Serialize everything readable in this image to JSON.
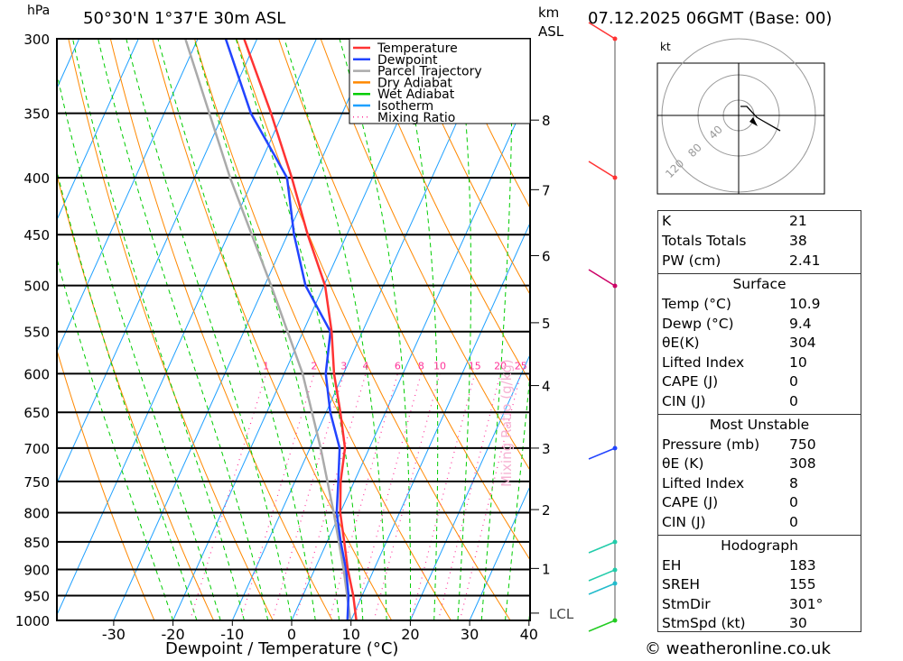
{
  "header": {
    "pressure_unit": "hPa",
    "location": "50°30'N 1°37'E 30m ASL",
    "km_unit": "km",
    "asl": "ASL",
    "datetime": "07.12.2025 06GMT (Base: 00)"
  },
  "legend": [
    {
      "label": "Temperature",
      "color": "#ff3333"
    },
    {
      "label": "Dewpoint",
      "color": "#2244ff"
    },
    {
      "label": "Parcel Trajectory",
      "color": "#aaaaaa"
    },
    {
      "label": "Dry Adiabat",
      "color": "#ff8800"
    },
    {
      "label": "Wet Adiabat",
      "color": "#00cc00"
    },
    {
      "label": "Isotherm",
      "color": "#1ea0ff"
    },
    {
      "label": "Mixing Ratio",
      "color": "#ff3399"
    }
  ],
  "chart_data": {
    "type": "line",
    "title": "",
    "xlabel": "Dewpoint / Temperature (°C)",
    "ylabel": "hPa",
    "y2label": "Mixing Ratio (g/kg)",
    "xlim": [
      -40,
      40
    ],
    "ylim": [
      1000,
      300
    ],
    "yscale": "log",
    "skew": true,
    "x_ticks": [
      -30,
      -20,
      -10,
      0,
      10,
      20,
      30,
      40
    ],
    "y_ticks": [
      300,
      350,
      400,
      450,
      500,
      550,
      600,
      650,
      700,
      750,
      800,
      850,
      900,
      950,
      1000
    ],
    "km_ticks": [
      {
        "km": "8",
        "p": 355
      },
      {
        "km": "7",
        "p": 410
      },
      {
        "km": "6",
        "p": 470
      },
      {
        "km": "5",
        "p": 540
      },
      {
        "km": "4",
        "p": 615
      },
      {
        "km": "3",
        "p": 700
      },
      {
        "km": "2",
        "p": 795
      },
      {
        "km": "1",
        "p": 898
      },
      {
        "km": "LCL",
        "p": 985
      }
    ],
    "mixing_ratio_labels": [
      1,
      2,
      3,
      4,
      6,
      8,
      10,
      15,
      20,
      25
    ],
    "pressure": [
      1000,
      950,
      900,
      850,
      800,
      750,
      700,
      650,
      600,
      550,
      500,
      450,
      400,
      350,
      300
    ],
    "series": [
      {
        "name": "Temperature",
        "color": "#ff3333",
        "values": [
          10.9,
          8.5,
          5.6,
          2.9,
          0,
          -2.3,
          -4.1,
          -7.6,
          -11.6,
          -15.2,
          -19.8,
          -26.6,
          -33.6,
          -42,
          -52.2
        ]
      },
      {
        "name": "Dewpoint",
        "color": "#2244ff",
        "values": [
          9.4,
          7.7,
          5.3,
          2.3,
          -0.6,
          -2.7,
          -5.0,
          -9.3,
          -13.0,
          -15.4,
          -23.1,
          -28.9,
          -34.4,
          -45.4,
          -55.3
        ]
      },
      {
        "name": "Parcel Trajectory",
        "color": "#aaaaaa",
        "pressure": [
          1000,
          900,
          800,
          700,
          600,
          500,
          400,
          300
        ],
        "values": [
          9.9,
          4.9,
          -1.1,
          -8.2,
          -16.9,
          -28.9,
          -44,
          -62.1
        ]
      }
    ]
  },
  "hodograph": {
    "unit": "kt",
    "rings": [
      "40",
      "80",
      "120"
    ]
  },
  "indices": {
    "top": [
      {
        "label": "K",
        "value": "21"
      },
      {
        "label": "Totals Totals",
        "value": "38"
      },
      {
        "label": "PW (cm)",
        "value": "2.41"
      }
    ],
    "surface": {
      "title": "Surface",
      "rows": [
        {
          "label": "Temp (°C)",
          "value": "10.9"
        },
        {
          "label": "Dewp (°C)",
          "value": "9.4"
        },
        {
          "label": "θE(K)",
          "value": "304"
        },
        {
          "label": "Lifted Index",
          "value": "10"
        },
        {
          "label": "CAPE (J)",
          "value": "0"
        },
        {
          "label": "CIN (J)",
          "value": "0"
        }
      ]
    },
    "most_unstable": {
      "title": "Most Unstable",
      "rows": [
        {
          "label": "Pressure (mb)",
          "value": "750"
        },
        {
          "label": "θE (K)",
          "value": "308"
        },
        {
          "label": "Lifted Index",
          "value": "8"
        },
        {
          "label": "CAPE (J)",
          "value": "0"
        },
        {
          "label": "CIN (J)",
          "value": "0"
        }
      ]
    },
    "hodograph": {
      "title": "Hodograph",
      "rows": [
        {
          "label": "EH",
          "value": "183"
        },
        {
          "label": "SREH",
          "value": "155"
        },
        {
          "label": "StmDir",
          "value": "301°"
        },
        {
          "label": "StmSpd (kt)",
          "value": "30"
        }
      ]
    }
  },
  "footer": {
    "copyright": "© weatheronline.co.uk"
  }
}
